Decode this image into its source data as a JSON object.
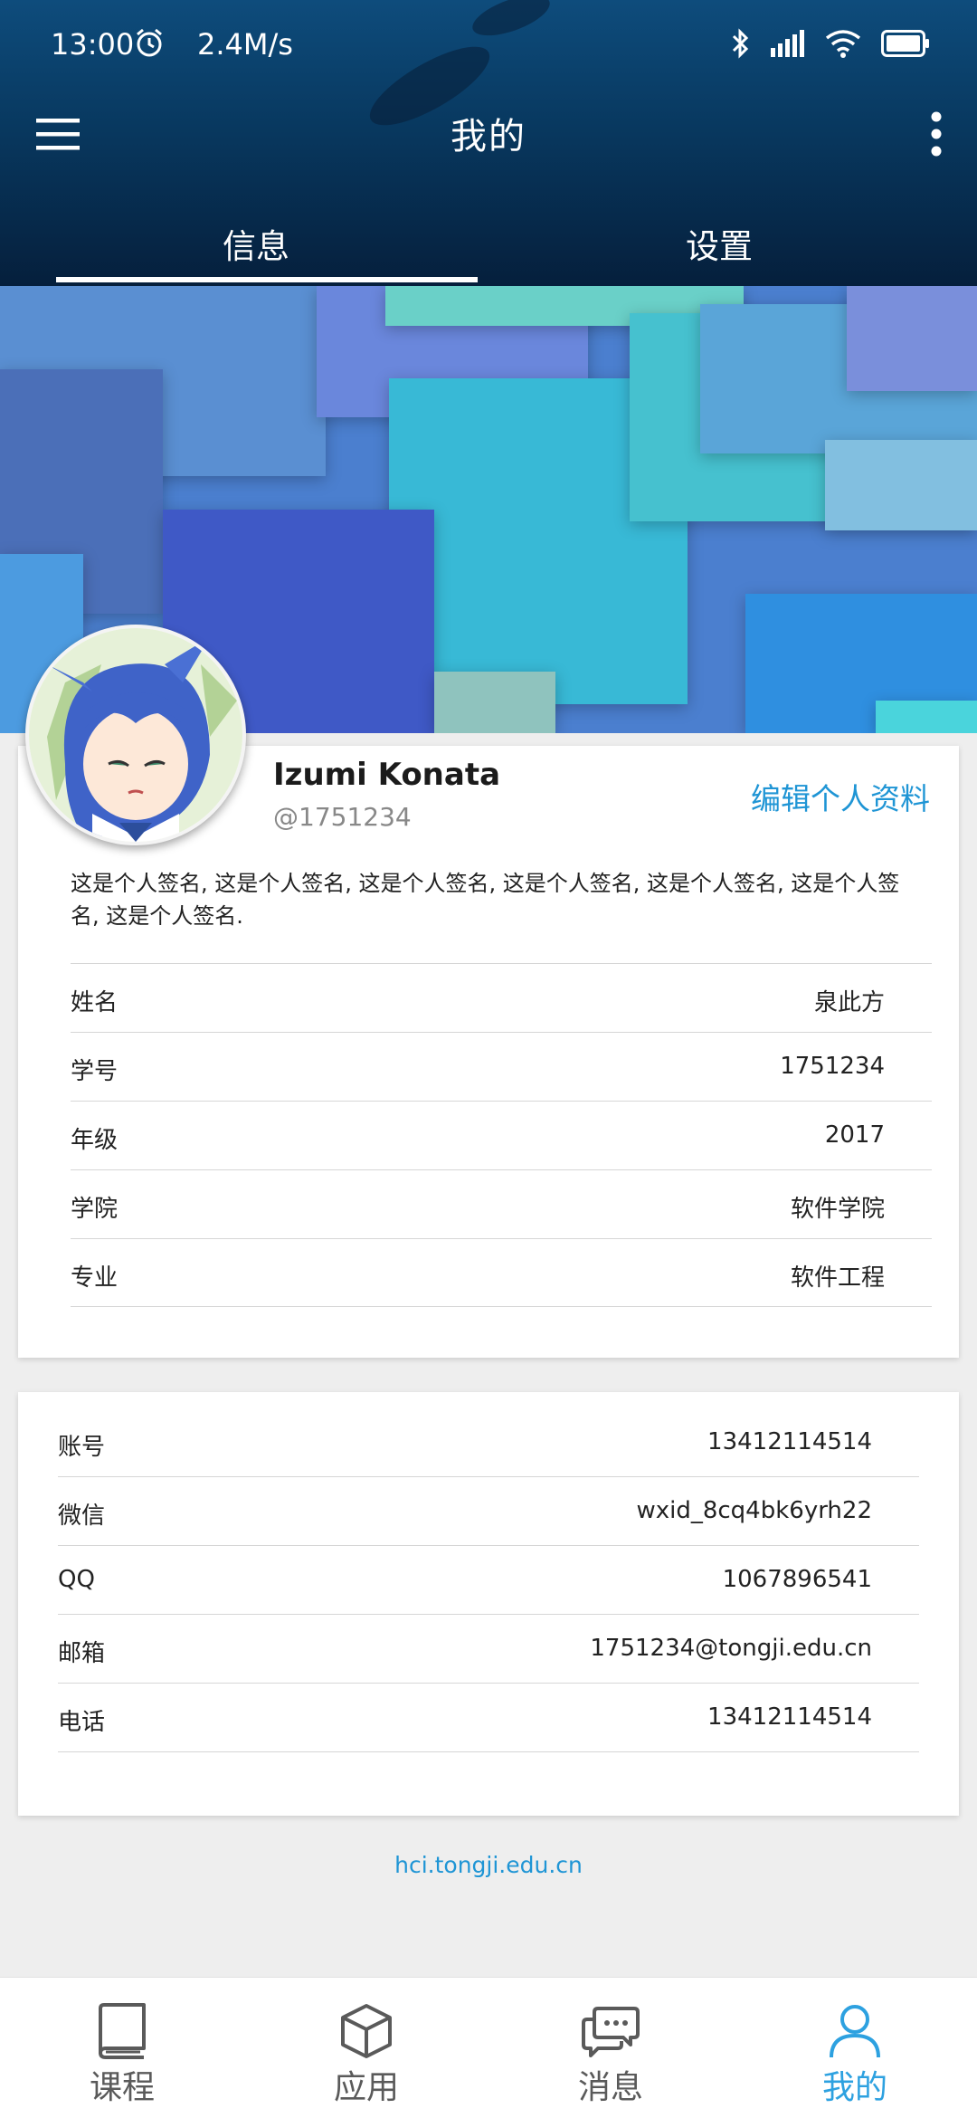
{
  "status_bar": {
    "time": "13:00",
    "speed": "2.4M/s"
  },
  "header": {
    "title": "我的",
    "tabs": [
      {
        "label": "信息",
        "active": true
      },
      {
        "label": "设置",
        "active": false
      }
    ]
  },
  "profile": {
    "name": "Izumi Konata",
    "handle": "@1751234",
    "edit_label": "编辑个人资料",
    "signature": "这是个人签名, 这是个人签名, 这是个人签名, 这是个人签名, 这是个人签名, 这是个人签名, 这是个人签名.",
    "fields": [
      {
        "label": "姓名",
        "value": "泉此方"
      },
      {
        "label": "学号",
        "value": "1751234"
      },
      {
        "label": "年级",
        "value": "2017"
      },
      {
        "label": "学院",
        "value": "软件学院"
      },
      {
        "label": "专业",
        "value": "软件工程"
      }
    ]
  },
  "contacts": [
    {
      "label": "账号",
      "value": "13412114514"
    },
    {
      "label": "微信",
      "value": "wxid_8cq4bk6yrh22"
    },
    {
      "label": "QQ",
      "value": "1067896541"
    },
    {
      "label": "邮箱",
      "value": "1751234@tongji.edu.cn"
    },
    {
      "label": "电话",
      "value": "13412114514"
    }
  ],
  "footer": {
    "link": "hci.tongji.edu.cn"
  },
  "bottom_nav": [
    {
      "label": "课程",
      "icon": "book-icon",
      "active": false
    },
    {
      "label": "应用",
      "icon": "cube-icon",
      "active": false
    },
    {
      "label": "消息",
      "icon": "chat-icon",
      "active": false
    },
    {
      "label": "我的",
      "icon": "person-icon",
      "active": true
    }
  ],
  "colors": {
    "accent": "#1f95d5",
    "active_nav": "#2da1e0",
    "header_dark": "#051f3c"
  }
}
